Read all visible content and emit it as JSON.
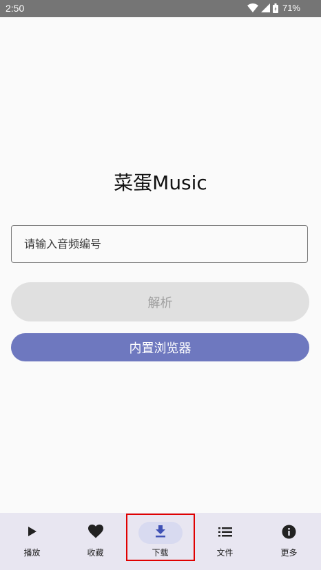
{
  "status_bar": {
    "time": "2:50",
    "battery": "71%",
    "icons": [
      "wifi-icon",
      "signal-icon",
      "battery-icon"
    ]
  },
  "main": {
    "title": "菜蛋Music",
    "input_placeholder": "请输入音频编号",
    "parse_button_label": "解析",
    "browser_button_label": "内置浏览器"
  },
  "bottom_nav": {
    "items": [
      {
        "label": "播放",
        "icon": "play-icon"
      },
      {
        "label": "收藏",
        "icon": "heart-icon"
      },
      {
        "label": "下载",
        "icon": "download-icon",
        "selected": true
      },
      {
        "label": "文件",
        "icon": "list-icon"
      },
      {
        "label": "更多",
        "icon": "info-icon"
      }
    ]
  },
  "colors": {
    "status_bar": "#757575",
    "background": "#fafafa",
    "accent": "#6e78bf",
    "nav_background": "#e8e6f1",
    "selected_indicator": "#d8daf0",
    "highlight_box": "#e00000"
  }
}
